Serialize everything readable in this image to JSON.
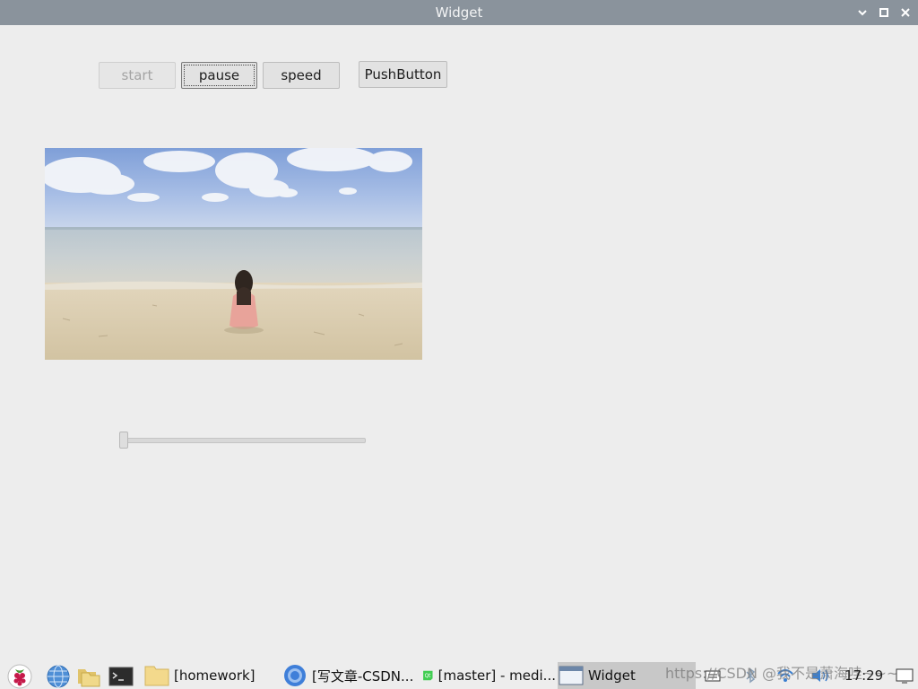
{
  "window": {
    "title": "Widget"
  },
  "controls": {
    "start_label": "start",
    "pause_label": "pause",
    "speed_label": "speed",
    "pushbutton_label": "PushButton"
  },
  "slider": {
    "value_fraction": 0.0
  },
  "taskbar": {
    "tasks": [
      {
        "label": "[homework]",
        "icon": "folder-icon"
      },
      {
        "label": "[写文章-CSDN...",
        "icon": "chromium-icon"
      },
      {
        "label": "[master] - medi...",
        "icon": "qt-creator-icon"
      },
      {
        "label": "Widget",
        "icon": "window-icon"
      }
    ],
    "watermark": "https://CSDN @我不是萧海哇~~~",
    "clock": "17:29"
  },
  "colors": {
    "titlebar": "#8a939c",
    "window_bg": "#ededed",
    "button_bg": "#e2e2e2",
    "active_task": "#c8c8c8"
  }
}
